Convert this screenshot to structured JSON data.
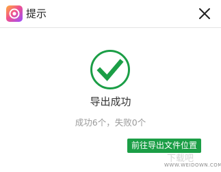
{
  "window": {
    "title": "提示",
    "app_icon": "photo-app-icon",
    "close_icon": "close-icon"
  },
  "dialog": {
    "status_icon": "checkmark-circle-icon",
    "message": "导出成功",
    "summary": "成功6个，失败0个",
    "action_button_label": "前往导出文件位置"
  },
  "watermark": {
    "text": "WWW.WEIDOWN.COM"
  },
  "colors": {
    "success_green": "#1b9e46",
    "icon_gradient_start": "#f0508c",
    "icon_gradient_end": "#9a4dff"
  }
}
